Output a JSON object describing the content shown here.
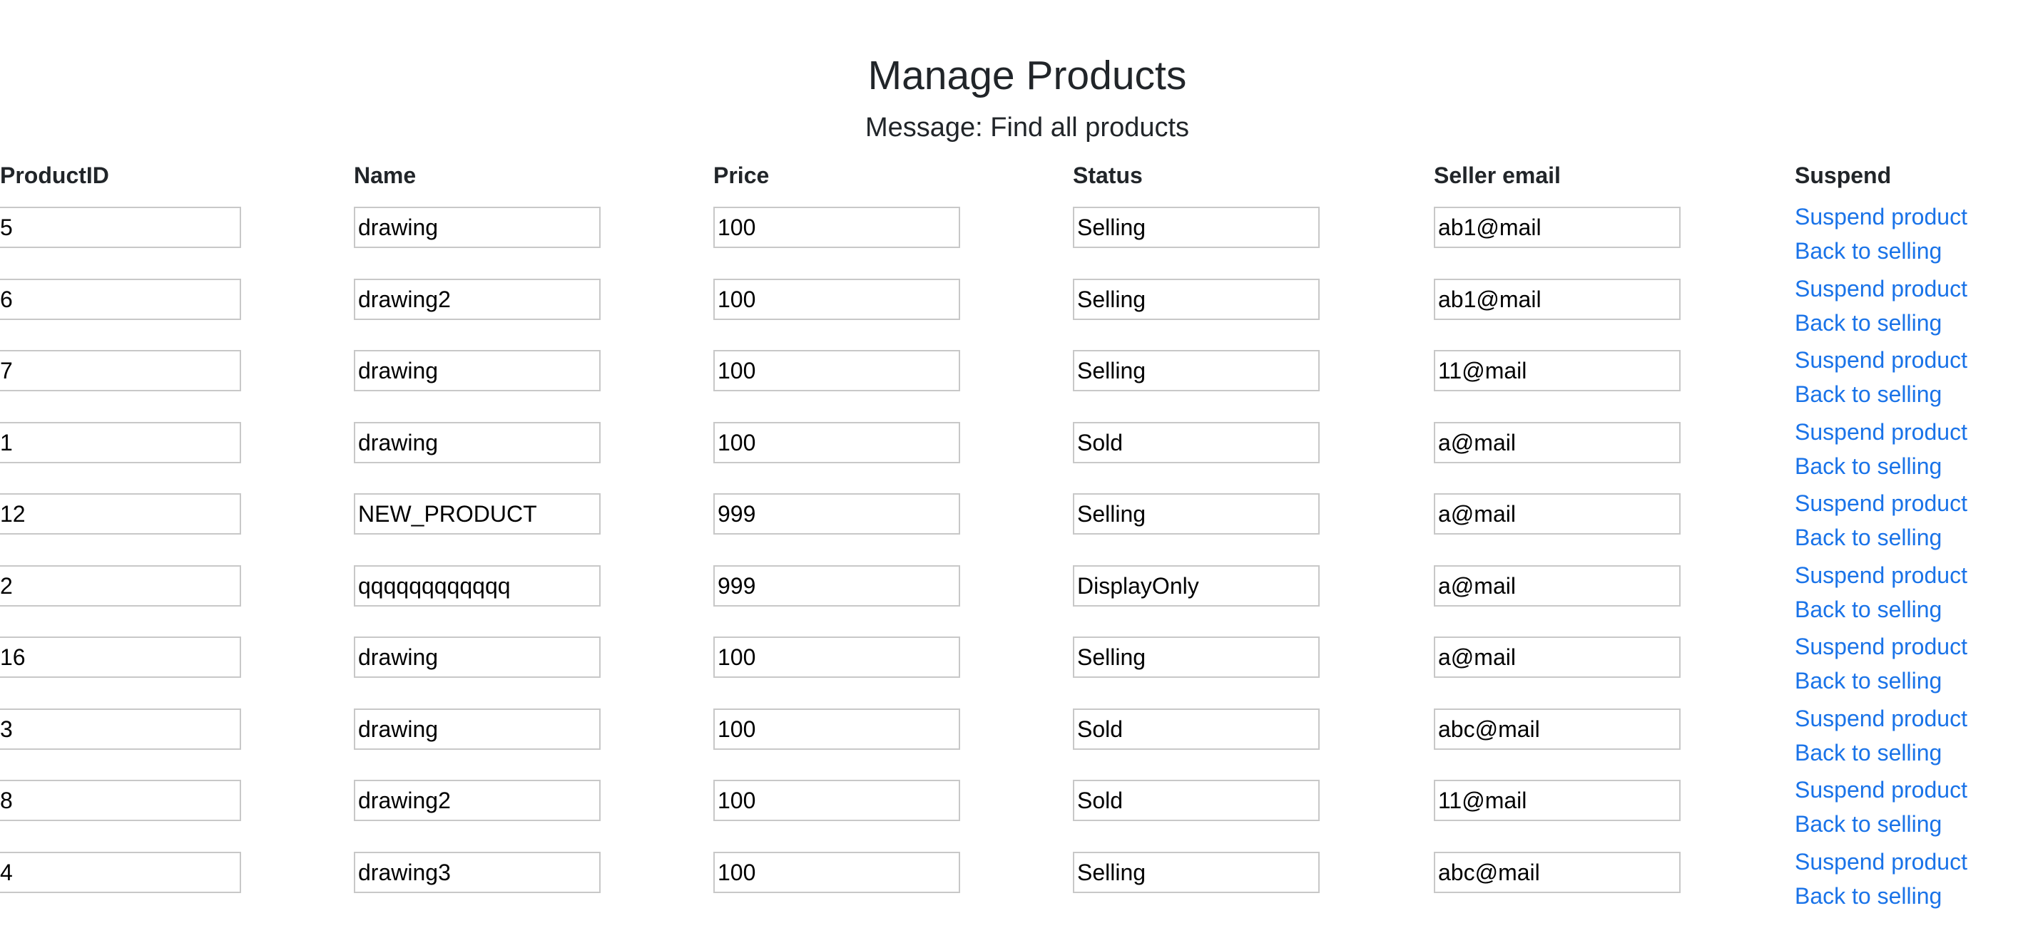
{
  "page": {
    "title": "Manage Products",
    "message": "Message: Find all products"
  },
  "table": {
    "headers": {
      "product_id": "ProductID",
      "name": "Name",
      "price": "Price",
      "status": "Status",
      "seller_email": "Seller email",
      "suspend": "Suspend"
    },
    "suspend_link_label": "Suspend product",
    "resume_link_label": "Back to selling",
    "rows": [
      {
        "product_id": "5",
        "name": "drawing",
        "price": "100",
        "status": "Selling",
        "seller_email": "ab1@mail"
      },
      {
        "product_id": "6",
        "name": "drawing2",
        "price": "100",
        "status": "Selling",
        "seller_email": "ab1@mail"
      },
      {
        "product_id": "7",
        "name": "drawing",
        "price": "100",
        "status": "Selling",
        "seller_email": "11@mail"
      },
      {
        "product_id": "1",
        "name": "drawing",
        "price": "100",
        "status": "Sold",
        "seller_email": "a@mail"
      },
      {
        "product_id": "12",
        "name": "NEW_PRODUCT",
        "price": "999",
        "status": "Selling",
        "seller_email": "a@mail"
      },
      {
        "product_id": "2",
        "name": "qqqqqqqqqqqq",
        "price": "999",
        "status": "DisplayOnly",
        "seller_email": "a@mail"
      },
      {
        "product_id": "16",
        "name": "drawing",
        "price": "100",
        "status": "Selling",
        "seller_email": "a@mail"
      },
      {
        "product_id": "3",
        "name": "drawing",
        "price": "100",
        "status": "Sold",
        "seller_email": "abc@mail"
      },
      {
        "product_id": "8",
        "name": "drawing2",
        "price": "100",
        "status": "Sold",
        "seller_email": "11@mail"
      },
      {
        "product_id": "4",
        "name": "drawing3",
        "price": "100",
        "status": "Selling",
        "seller_email": "abc@mail"
      }
    ]
  },
  "colors": {
    "link": "#1a73e8",
    "text": "#212529",
    "input_border": "#c8c8c8"
  }
}
